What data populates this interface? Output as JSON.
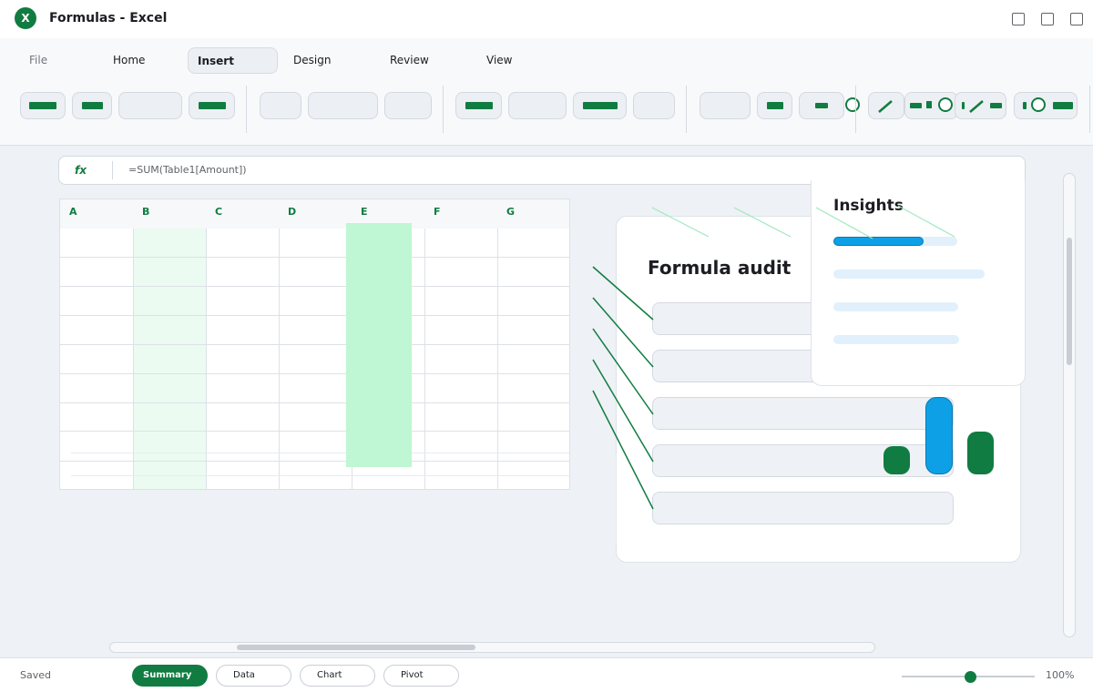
{
  "window": {
    "title": "Formulas - Excel",
    "logo_letter": "X"
  },
  "ribbon_tabs": [
    {
      "label": "File",
      "state": "muted"
    },
    {
      "label": "Home",
      "state": "normal"
    },
    {
      "label": "Insert",
      "state": "active"
    },
    {
      "label": "Design",
      "state": "normal"
    },
    {
      "label": "Review",
      "state": "normal"
    },
    {
      "label": "View",
      "state": "normal"
    }
  ],
  "formula_bar": {
    "label": "fx",
    "value": "=SUM(Table1[Amount])"
  },
  "grid": {
    "columns": [
      "A",
      "B",
      "C",
      "D",
      "E",
      "F",
      "G"
    ]
  },
  "audit": {
    "title": "Formula audit"
  },
  "insights": {
    "title": "Insights",
    "progress_levels": [
      0.73,
      0,
      0,
      0
    ]
  },
  "status": {
    "text": "Saved",
    "sheets": [
      {
        "label": "Summary",
        "active": true
      },
      {
        "label": "Data",
        "active": false
      },
      {
        "label": "Chart",
        "active": false
      },
      {
        "label": "Pivot",
        "active": false
      }
    ],
    "zoom": "100%",
    "zoom_level": 0.52
  },
  "colors": {
    "brand": "#107c41",
    "accent_blue": "#0ea0e6",
    "highlight_green": "#bff6d3"
  }
}
